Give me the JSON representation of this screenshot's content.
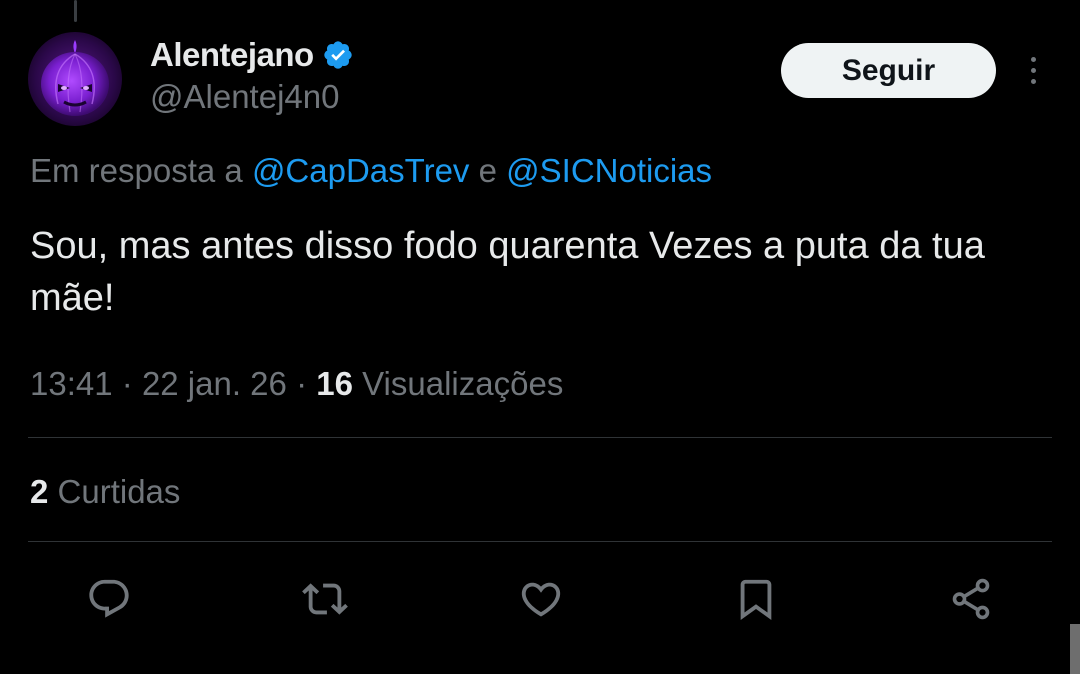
{
  "author": {
    "display_name": "Alentejano",
    "handle": "@Alentej4n0",
    "verified": true
  },
  "follow_button_label": "Seguir",
  "reply_context": {
    "prefix": "Em resposta a",
    "mention_1": "@CapDasTrev",
    "connector": "e",
    "mention_2": "@SICNoticias"
  },
  "tweet": {
    "text": "Sou, mas antes disso fodo quarenta Vezes a puta da tua mãe!"
  },
  "meta": {
    "time": "13:41",
    "separator": "·",
    "date": "22 jan. 26",
    "views_count": "16",
    "views_label": "Visualizações"
  },
  "engagement": {
    "likes_count": "2",
    "likes_label": "Curtidas"
  },
  "actions": [
    {
      "name": "reply",
      "icon": "reply-icon"
    },
    {
      "name": "repost",
      "icon": "repost-icon"
    },
    {
      "name": "like",
      "icon": "heart-icon"
    },
    {
      "name": "bookmark",
      "icon": "bookmark-icon"
    },
    {
      "name": "share",
      "icon": "share-icon"
    }
  ],
  "colors": {
    "background": "#000000",
    "text_primary": "#e7e9ea",
    "text_secondary": "#71767b",
    "accent_blue": "#1d9bf0",
    "divider": "#2f3336",
    "follow_button_bg": "#eff3f4"
  }
}
